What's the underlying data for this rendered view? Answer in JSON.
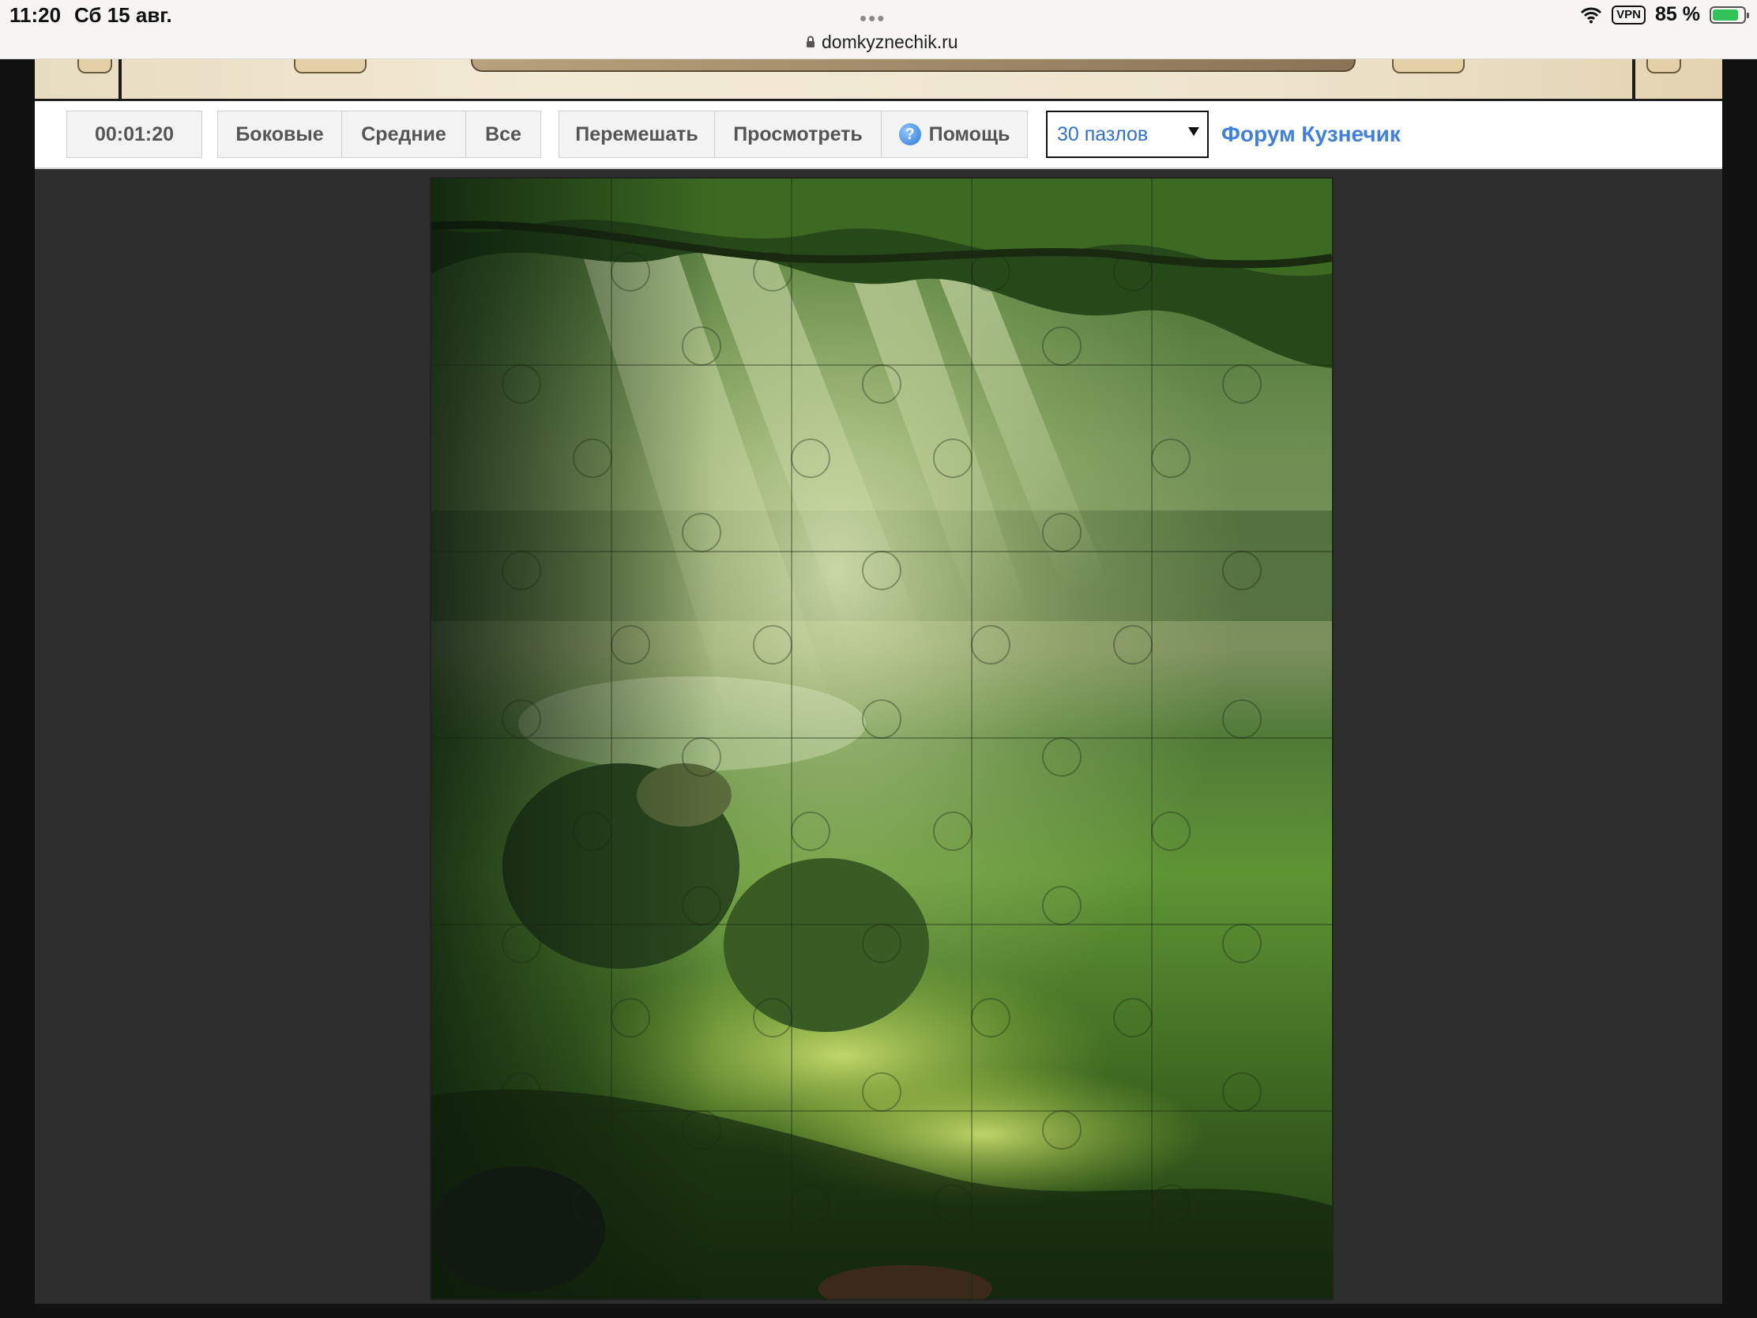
{
  "status_bar": {
    "time": "11:20",
    "date": "Сб 15 авг.",
    "url": "domkyznechik.ru",
    "vpn": "VPN",
    "battery": "85 %",
    "battery_level": 0.85,
    "icons": [
      "wifi-icon",
      "lock-icon",
      "battery-icon"
    ]
  },
  "toolbar": {
    "timer": "00:01:20",
    "filter_buttons": [
      "Боковые",
      "Средние",
      "Все"
    ],
    "action_buttons": {
      "shuffle": "Перемешать",
      "preview": "Просмотреть",
      "help": "Помощь"
    },
    "pieces_select": "30 пазлов",
    "forum_link": "Форум Кузнечик"
  },
  "puzzle": {
    "image_subject": "forest-clearing-sunbeams",
    "columns": 5,
    "rows": 6,
    "colors": {
      "canopy": "#2f5a1f",
      "light": "#d9e9a3",
      "grass": "#5b8f2e",
      "shadow": "#0f1f0c"
    }
  },
  "colors": {
    "page_background": "#2e2e2e",
    "accent_link": "#3f7fe0",
    "select_text": "#2f6fd6"
  }
}
